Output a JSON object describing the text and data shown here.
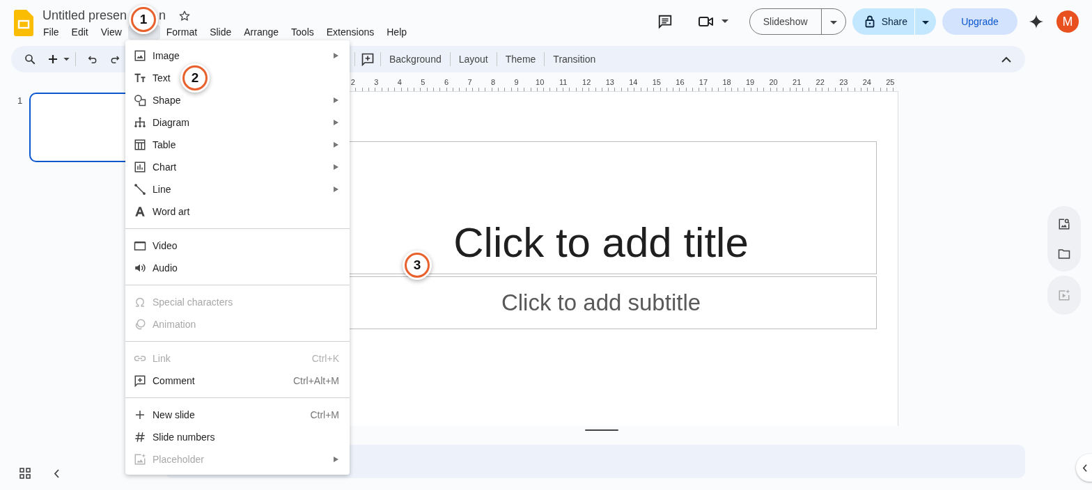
{
  "app": {
    "title": "Untitled presen",
    "title_tail": "n",
    "menus": [
      {
        "label": "File",
        "selected": false
      },
      {
        "label": "Edit",
        "selected": false
      },
      {
        "label": "View",
        "selected": false
      },
      {
        "selected": true
      },
      {
        "label": "Format",
        "selected": false
      },
      {
        "label": "Slide",
        "selected": false
      },
      {
        "label": "Arrange",
        "selected": false
      },
      {
        "label": "Tools",
        "selected": false
      },
      {
        "label": "Extensions",
        "selected": false
      },
      {
        "label": "Help",
        "selected": false
      }
    ]
  },
  "header": {
    "slideshow": "Slideshow",
    "share": "Share",
    "upgrade": "Upgrade",
    "avatar": "M"
  },
  "toolbar": {
    "items": [
      {
        "label": "Background"
      },
      {
        "label": "Layout"
      },
      {
        "label": "Theme"
      },
      {
        "label": "Transition"
      }
    ]
  },
  "filmstrip": {
    "slides": [
      {
        "number": "1",
        "selected": true
      }
    ]
  },
  "ruler": {
    "marks": [
      "2",
      "3",
      "4",
      "5",
      "6",
      "7",
      "8",
      "9",
      "10",
      "11",
      "12",
      "13",
      "14",
      "15",
      "16",
      "17",
      "18",
      "19",
      "20",
      "21",
      "22",
      "23",
      "24",
      "25"
    ]
  },
  "slide": {
    "title_placeholder": "Click to add title",
    "subtitle_placeholder": "Click to add subtitle"
  },
  "insert_menu": {
    "sections": [
      [
        {
          "kind": "image",
          "label": "Image",
          "submenu": true,
          "disabled": false
        },
        {
          "kind": "text",
          "label": "Text",
          "submenu": false,
          "disabled": false
        },
        {
          "kind": "shape",
          "label": "Shape",
          "submenu": true,
          "disabled": false
        },
        {
          "kind": "diagram",
          "label": "Diagram",
          "submenu": true,
          "disabled": false
        },
        {
          "kind": "table",
          "label": "Table",
          "submenu": true,
          "disabled": false
        },
        {
          "kind": "chart",
          "label": "Chart",
          "submenu": true,
          "disabled": false
        },
        {
          "kind": "line",
          "label": "Line",
          "submenu": true,
          "disabled": false
        },
        {
          "kind": "wordart",
          "label": "Word art",
          "submenu": false,
          "disabled": false
        }
      ],
      [
        {
          "kind": "video",
          "label": "Video",
          "submenu": false,
          "disabled": false
        },
        {
          "kind": "audio",
          "label": "Audio",
          "submenu": false,
          "disabled": false
        }
      ],
      [
        {
          "kind": "special",
          "label": "Special characters",
          "submenu": false,
          "disabled": true
        },
        {
          "kind": "animation",
          "label": "Animation",
          "submenu": false,
          "disabled": true
        }
      ],
      [
        {
          "kind": "link",
          "label": "Link",
          "shortcut": "Ctrl+K",
          "submenu": false,
          "disabled": true
        },
        {
          "kind": "comment",
          "label": "Comment",
          "shortcut": "Ctrl+Alt+M",
          "submenu": false,
          "disabled": false
        }
      ],
      [
        {
          "kind": "plus",
          "label": "New slide",
          "shortcut": "Ctrl+M",
          "submenu": false,
          "disabled": false
        },
        {
          "kind": "hash",
          "label": "Slide numbers",
          "submenu": false,
          "disabled": false
        },
        {
          "kind": "placeholder",
          "label": "Placeholder",
          "submenu": true,
          "disabled": true
        }
      ]
    ]
  },
  "callouts": [
    {
      "label": "1"
    },
    {
      "label": "2"
    },
    {
      "label": "3"
    }
  ]
}
